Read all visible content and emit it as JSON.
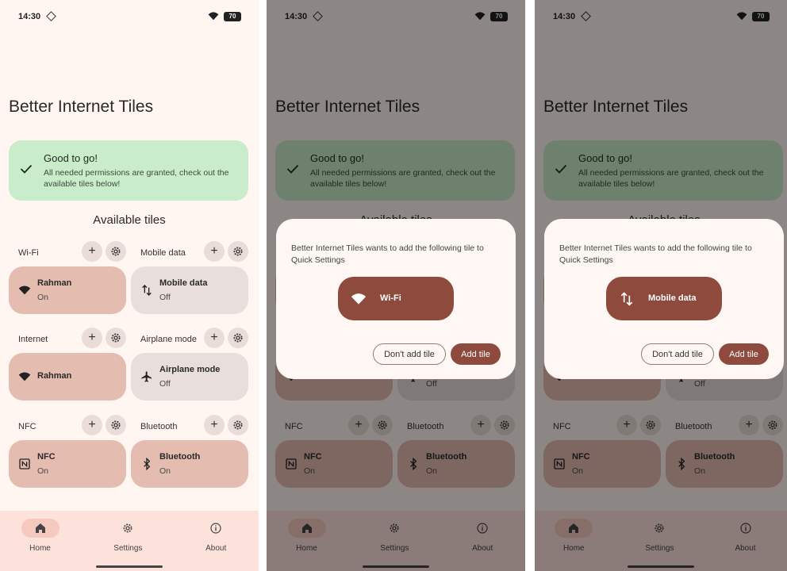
{
  "status": {
    "time": "14:30",
    "battery": "70"
  },
  "app": {
    "title": "Better Internet Tiles"
  },
  "ready_card": {
    "title": "Good to go!",
    "message": "All needed permissions are granted, check out the available tiles below!"
  },
  "available_heading": "Available tiles",
  "controls": {
    "add": "+",
    "settings_glyph": "⚙"
  },
  "sections": [
    {
      "left": {
        "label": "Wi-Fi",
        "tile_name": "Rahman",
        "tile_state": "On",
        "active": true,
        "icon": "wifi-icon"
      },
      "right": {
        "label": "Mobile data",
        "tile_name": "Mobile data",
        "tile_state": "Off",
        "active": false,
        "icon": "mobile-data-icon"
      }
    },
    {
      "left": {
        "label": "Internet",
        "tile_name": "Rahman",
        "tile_state": "",
        "active": true,
        "icon": "wifi-icon"
      },
      "right": {
        "label": "Airplane mode",
        "tile_name": "Airplane mode",
        "tile_state": "Off",
        "active": false,
        "icon": "airplane-icon"
      }
    },
    {
      "left": {
        "label": "NFC",
        "tile_name": "NFC",
        "tile_state": "On",
        "active": true,
        "icon": "nfc-icon"
      },
      "right": {
        "label": "Bluetooth",
        "tile_name": "Bluetooth",
        "tile_state": "On",
        "active": true,
        "icon": "bluetooth-icon"
      }
    }
  ],
  "nav": [
    {
      "label": "Home",
      "icon": "home-icon",
      "active": true
    },
    {
      "label": "Settings",
      "icon": "gear-icon",
      "active": false
    },
    {
      "label": "About",
      "icon": "info-icon",
      "active": false
    }
  ],
  "dialogs": [
    {
      "prompt": "Better Internet Tiles wants to add the following tile to Quick Settings",
      "tile_name": "Wi-Fi",
      "tile_icon": "wifi-icon",
      "cancel": "Don't add tile",
      "confirm": "Add tile"
    },
    {
      "prompt": "Better Internet Tiles wants to add the following tile to Quick Settings",
      "tile_name": "Mobile data",
      "tile_icon": "mobile-data-icon",
      "cancel": "Don't add tile",
      "confirm": "Add tile"
    }
  ],
  "colors": {
    "background": "#fff6f2",
    "tile_active": "#e5bcb0",
    "tile_inactive": "#e8dfdc",
    "accent": "#8e4a3c",
    "success_card": "#c9eccb",
    "nav_bar": "#fde2dc"
  }
}
